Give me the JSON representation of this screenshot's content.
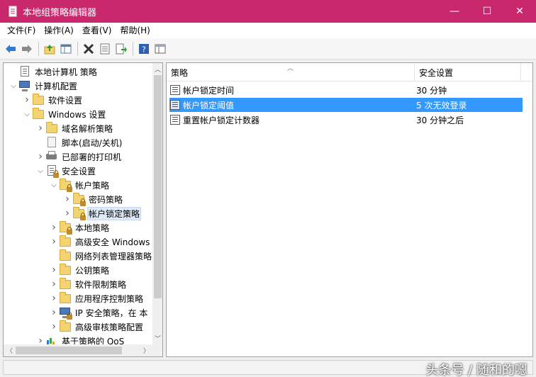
{
  "window": {
    "title": "本地组策略编辑器",
    "minimize_glyph": "—",
    "maximize_glyph": "☐",
    "close_glyph": "✕"
  },
  "menu": [
    {
      "label": "文件(F)"
    },
    {
      "label": "操作(A)"
    },
    {
      "label": "查看(V)"
    },
    {
      "label": "帮助(H)"
    }
  ],
  "toolbar": {
    "icons": [
      "back-arrow-icon",
      "forward-arrow-icon",
      "up-folder-icon",
      "show-hide-tree-icon",
      "delete-icon",
      "properties-icon",
      "export-list-icon",
      "help-icon",
      "console-view-icon"
    ]
  },
  "tree": {
    "items": [
      {
        "label": "本地计算机 策略",
        "level": 0,
        "expander": "",
        "icon": "policy-document-icon"
      },
      {
        "label": "计算机配置",
        "level": 0,
        "expander": "open",
        "icon": "computer-icon"
      },
      {
        "label": "软件设置",
        "level": 1,
        "expander": "closed",
        "icon": "folder-icon"
      },
      {
        "label": "Windows 设置",
        "level": 1,
        "expander": "open",
        "icon": "folder-icon"
      },
      {
        "label": "域名解析策略",
        "level": 2,
        "expander": "closed",
        "icon": "folder-icon"
      },
      {
        "label": "脚本(启动/关机)",
        "level": 2,
        "expander": "",
        "icon": "script-icon"
      },
      {
        "label": "已部署的打印机",
        "level": 2,
        "expander": "closed",
        "icon": "printer-icon"
      },
      {
        "label": "安全设置",
        "level": 2,
        "expander": "open",
        "icon": "security-icon"
      },
      {
        "label": "帐户策略",
        "level": 3,
        "expander": "open",
        "icon": "locked-folder-icon"
      },
      {
        "label": "密码策略",
        "level": 4,
        "expander": "closed",
        "icon": "locked-folder-icon"
      },
      {
        "label": "帐户锁定策略",
        "level": 4,
        "expander": "closed",
        "icon": "locked-folder-icon",
        "selected": true
      },
      {
        "label": "本地策略",
        "level": 3,
        "expander": "closed",
        "icon": "locked-folder-icon"
      },
      {
        "label": "高级安全 Windows",
        "level": 3,
        "expander": "closed",
        "icon": "folder-icon"
      },
      {
        "label": "网络列表管理器策略",
        "level": 3,
        "expander": "",
        "icon": "folder-icon"
      },
      {
        "label": "公钥策略",
        "level": 3,
        "expander": "closed",
        "icon": "folder-icon"
      },
      {
        "label": "软件限制策略",
        "level": 3,
        "expander": "closed",
        "icon": "folder-icon"
      },
      {
        "label": "应用程序控制策略",
        "level": 3,
        "expander": "closed",
        "icon": "folder-icon"
      },
      {
        "label": "IP 安全策略，在 本",
        "level": 3,
        "expander": "closed",
        "icon": "ip-security-icon"
      },
      {
        "label": "高级审核策略配置",
        "level": 3,
        "expander": "closed",
        "icon": "folder-icon"
      },
      {
        "label": "基于策略的 QoS",
        "level": 2,
        "expander": "closed",
        "icon": "chart-icon"
      }
    ],
    "scroll_up_glyph": "︿",
    "scroll_down_glyph": "﹀",
    "scroll_left_glyph": "〈",
    "scroll_right_glyph": "〉"
  },
  "list": {
    "columns": [
      {
        "label": "策略"
      },
      {
        "label": "安全设置"
      }
    ],
    "sort_glyph": "︿",
    "rows": [
      {
        "name": "帐户锁定时间",
        "value": "30 分钟"
      },
      {
        "name": "帐户锁定阈值",
        "value": "5 次无效登录",
        "selected": true
      },
      {
        "name": "重置帐户锁定计数器",
        "value": "30 分钟之后"
      }
    ]
  },
  "watermark": "头条号 / 随和的嗯",
  "colors": {
    "titlebar": "#c9286d",
    "selection": "#3399ff"
  }
}
